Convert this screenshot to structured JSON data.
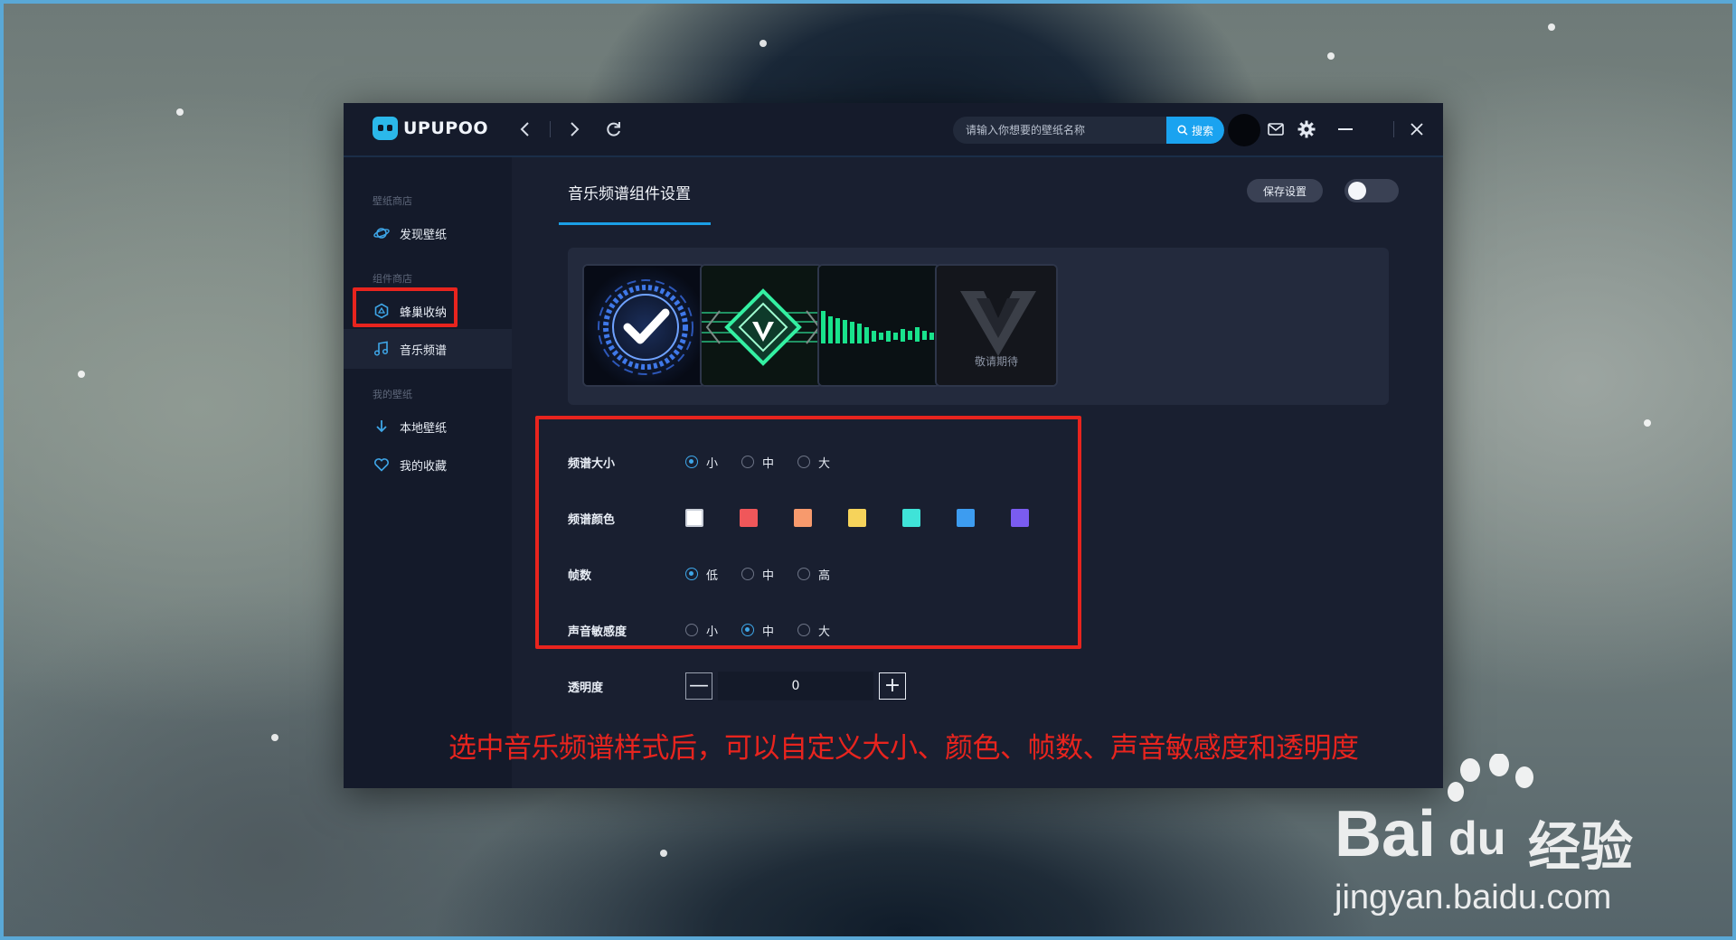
{
  "app": {
    "logo_text": "UPUPOO",
    "search": {
      "placeholder": "请输入你想要的壁纸名称",
      "button_label": "搜索"
    }
  },
  "sidebar": {
    "section_store": "壁纸商店",
    "discover": "发现壁纸",
    "section_widgets": "组件商店",
    "hive": "蜂巢收纳",
    "music": "音乐频谱",
    "section_mine": "我的壁纸",
    "local": "本地壁纸",
    "favorites": "我的收藏"
  },
  "main": {
    "tab_title": "音乐频谱组件设置",
    "save_label": "保存设置",
    "toggle_on": false,
    "styles": [
      {
        "name": "checkmark-ring-style"
      },
      {
        "name": "diamond-glitch-style"
      },
      {
        "name": "green-bars-style"
      },
      {
        "name": "coming-soon",
        "label": "敬请期待"
      }
    ],
    "settings": {
      "size": {
        "label": "频谱大小",
        "options": [
          "小",
          "中",
          "大"
        ],
        "selected": "小"
      },
      "color": {
        "label": "频谱颜色",
        "swatches": [
          "#ffffff",
          "#f0575a",
          "#f79a6d",
          "#f6d35b",
          "#3fe3d8",
          "#3d9cf0",
          "#7a5cf0"
        ],
        "selected": "#ffffff"
      },
      "fps": {
        "label": "帧数",
        "options": [
          "低",
          "中",
          "高"
        ],
        "selected": "低"
      },
      "sensitivity": {
        "label": "声音敏感度",
        "options": [
          "小",
          "中",
          "大"
        ],
        "selected": "中"
      },
      "opacity": {
        "label": "透明度",
        "value": "0",
        "minus": "—",
        "plus": "+"
      }
    }
  },
  "caption": "选中音乐频谱样式后，可以自定义大小、颜色、帧数、声音敏感度和透明度",
  "watermark": {
    "brand_a": "Bai",
    "brand_b": "du",
    "brand_c": "经验",
    "url": "jingyan.baidu.com"
  },
  "colors": {
    "accent": "#1aa3f0",
    "highlight": "#e8241e",
    "window_bg": "#141a2a"
  }
}
